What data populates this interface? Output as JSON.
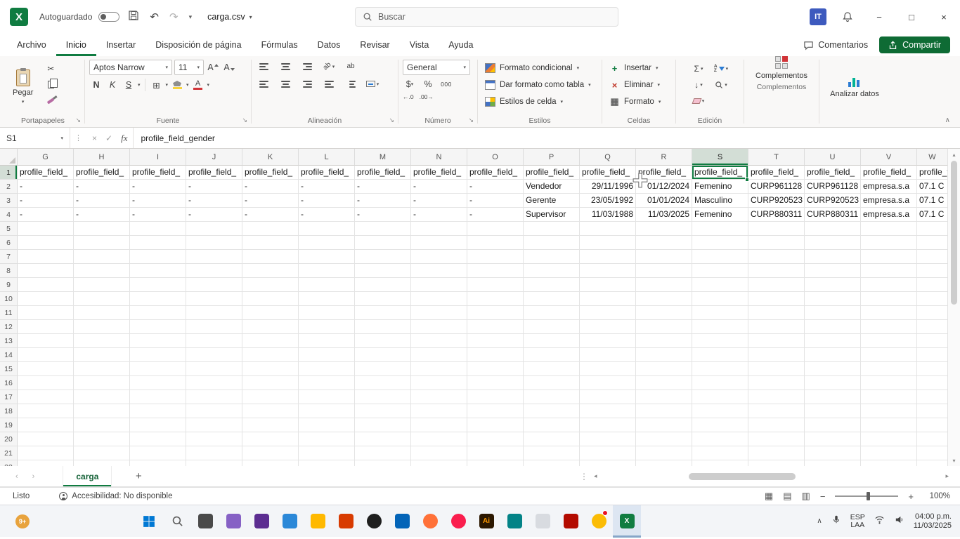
{
  "colors": {
    "excel_green": "#107c41",
    "share_button": "#0e6b34",
    "selected_header_bg": "#d3ded6",
    "fill_swatch": "#f7d33c",
    "font_color_swatch": "#d13438"
  },
  "glyphs": {
    "caret_down": "▾",
    "launcher": "↘",
    "collapse_ribbon": "∧",
    "undo": "↶",
    "redo": "↷",
    "scissors": "✂",
    "sigma": "Σ",
    "fill_down": "↓",
    "borders": "⊞",
    "grid_view": "▦",
    "page_view": "▤",
    "break_view": "▥",
    "minimize": "−",
    "maximize": "□",
    "close": "×",
    "check": "✓",
    "cancel": "×",
    "dots": "⋮",
    "plus": "+",
    "delete_x": "×",
    "format_grid": "▦",
    "nav_left": "‹",
    "nav_right": "›",
    "tri_left": "◂",
    "tri_right": "▸",
    "tri_up": "▴",
    "tri_down": "▾",
    "tray_chevron": "∧",
    "minus": "−",
    "letter_a": "A",
    "letter_z": "Z",
    "dec_inc": "←.0",
    "dec_dec": ".00→"
  },
  "titlebar": {
    "autosave_label": "Autoguardado",
    "filename": "carga.csv",
    "search_placeholder": "Buscar",
    "user_initials": "IT"
  },
  "tabs": {
    "items": [
      {
        "label": "Archivo",
        "active": false
      },
      {
        "label": "Inicio",
        "active": true
      },
      {
        "label": "Insertar",
        "active": false
      },
      {
        "label": "Disposición de página",
        "active": false
      },
      {
        "label": "Fórmulas",
        "active": false
      },
      {
        "label": "Datos",
        "active": false
      },
      {
        "label": "Revisar",
        "active": false
      },
      {
        "label": "Vista",
        "active": false
      },
      {
        "label": "Ayuda",
        "active": false
      }
    ],
    "comments_label": "Comentarios",
    "share_label": "Compartir"
  },
  "ribbon": {
    "paste": "Pegar",
    "group_clipboard": "Portapapeles",
    "font_name": "Aptos Narrow",
    "font_size": "11",
    "bold": "N",
    "italic": "K",
    "underline": "S",
    "group_font": "Fuente",
    "ab": "ab",
    "group_alignment": "Alineación",
    "number_format": "General",
    "currency": "$",
    "percent": "%",
    "thousands": "000",
    "group_number": "Número",
    "conditional": "Formato condicional",
    "format_table": "Dar formato como tabla",
    "cell_styles": "Estilos de celda",
    "group_styles": "Estilos",
    "insert": "Insertar",
    "delete": "Eliminar",
    "format": "Formato",
    "group_cells": "Celdas",
    "group_editing": "Edición",
    "addins": "Complementos",
    "group_addins": "Complementos",
    "analyze": "Analizar datos"
  },
  "formula_bar": {
    "name_box": "S1",
    "fx": "fx",
    "value": "profile_field_gender"
  },
  "grid": {
    "columns": [
      "G",
      "H",
      "I",
      "J",
      "K",
      "L",
      "M",
      "N",
      "O",
      "P",
      "Q",
      "R",
      "S",
      "T",
      "U",
      "V"
    ],
    "partial_column": "W",
    "selected_column": "S",
    "selected_row": 1,
    "row_count": 22,
    "header_text": "profile_field_",
    "data_rows": [
      {
        "row": 2,
        "cells": [
          "-",
          "-",
          "-",
          "-",
          "-",
          "-",
          "-",
          "-",
          "-",
          "Vendedor",
          "29/11/1996",
          "01/12/2024",
          "Femenino",
          "CURP961128",
          "CURP961128",
          "empresa.s.a",
          "07.1 C"
        ]
      },
      {
        "row": 3,
        "cells": [
          "-",
          "-",
          "-",
          "-",
          "-",
          "-",
          "-",
          "-",
          "-",
          "Gerente",
          "23/05/1992",
          "01/01/2024",
          "Masculino",
          "CURP920523",
          "CURP920523",
          "empresa.s.a",
          "07.1 C"
        ]
      },
      {
        "row": 4,
        "cells": [
          "-",
          "-",
          "-",
          "-",
          "-",
          "-",
          "-",
          "-",
          "-",
          "Supervisor",
          "11/03/1988",
          "11/03/2025",
          "Femenino",
          "CURP880311",
          "CURP880311",
          "empresa.s.a",
          "07.1 C"
        ]
      }
    ]
  },
  "sheetbar": {
    "tab": "carga"
  },
  "statusbar": {
    "status": "Listo",
    "accessibility": "Accesibilidad: No disponible",
    "zoom": "100%"
  },
  "taskbar": {
    "badge": "9+",
    "lang1": "ESP",
    "lang2": "LAA",
    "time": "04:00 p.m.",
    "date": "11/03/2025",
    "icons": [
      {
        "name": "start",
        "shape": "win"
      },
      {
        "name": "search",
        "shape": "lens"
      },
      {
        "name": "task-view",
        "shape": "sq",
        "color": "#4a4a4a"
      },
      {
        "name": "app-purple",
        "shape": "sq",
        "color": "#8661c5"
      },
      {
        "name": "app-violet",
        "shape": "sq",
        "color": "#5c2d91"
      },
      {
        "name": "app-blue",
        "shape": "sq",
        "color": "#2b88d8"
      },
      {
        "name": "file-explorer",
        "shape": "sq",
        "color": "#ffb900"
      },
      {
        "name": "app-orange",
        "shape": "sq",
        "color": "#d83b01"
      },
      {
        "name": "app-black",
        "shape": "circle",
        "color": "#1f1f1f"
      },
      {
        "name": "outlook",
        "shape": "sq",
        "color": "#0364b8"
      },
      {
        "name": "firefox",
        "shape": "circle",
        "color": "#ff7139"
      },
      {
        "name": "opera",
        "shape": "circle",
        "color": "#fa1e4e"
      },
      {
        "name": "illustrator",
        "shape": "sq",
        "color": "#2b1700",
        "letter": "Ai",
        "letterColor": "#ff9a00"
      },
      {
        "name": "app-teal",
        "shape": "sq",
        "color": "#038387"
      },
      {
        "name": "app-light",
        "shape": "sq",
        "color": "#d8dbe0"
      },
      {
        "name": "acrobat",
        "shape": "sq",
        "color": "#b30b00"
      },
      {
        "name": "chrome",
        "shape": "circle",
        "color": "#fbbc05",
        "dot": true
      },
      {
        "name": "excel",
        "shape": "sq",
        "color": "#107c41",
        "letter": "X",
        "letterColor": "#ffffff",
        "active": true
      }
    ]
  }
}
